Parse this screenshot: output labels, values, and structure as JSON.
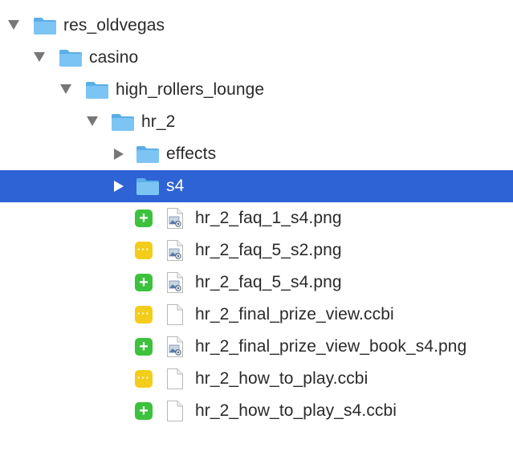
{
  "colors": {
    "selection": "#2e63d6",
    "folder": "#64b6f0",
    "added_badge": "#3cc23c",
    "modified_badge": "#f4cd1a"
  },
  "tree": {
    "folders": [
      {
        "label": "res_oldvegas",
        "expanded": true,
        "icon": "folder-icon"
      },
      {
        "label": "casino",
        "expanded": true,
        "icon": "folder-icon"
      },
      {
        "label": "high_rollers_lounge",
        "expanded": true,
        "icon": "folder-icon"
      },
      {
        "label": "hr_2",
        "expanded": true,
        "icon": "folder-icon"
      },
      {
        "label": "effects",
        "expanded": false,
        "icon": "folder-icon"
      },
      {
        "label": "s4",
        "expanded": false,
        "selected": true,
        "icon": "folder-icon"
      }
    ],
    "files": [
      {
        "label": "hr_2_faq_1_s4.png",
        "status": "added",
        "status_symbol": "+",
        "type": "image-file-icon"
      },
      {
        "label": "hr_2_faq_5_s2.png",
        "status": "modified",
        "status_symbol": "···",
        "type": "image-file-icon"
      },
      {
        "label": "hr_2_faq_5_s4.png",
        "status": "added",
        "status_symbol": "+",
        "type": "image-file-icon"
      },
      {
        "label": "hr_2_final_prize_view.ccbi",
        "status": "modified",
        "status_symbol": "···",
        "type": "document-file-icon"
      },
      {
        "label": "hr_2_final_prize_view_book_s4.png",
        "status": "added",
        "status_symbol": "+",
        "type": "image-file-icon"
      },
      {
        "label": "hr_2_how_to_play.ccbi",
        "status": "modified",
        "status_symbol": "···",
        "type": "document-file-icon"
      },
      {
        "label": "hr_2_how_to_play_s4.ccbi",
        "status": "added",
        "status_symbol": "+",
        "type": "document-file-icon"
      }
    ]
  }
}
